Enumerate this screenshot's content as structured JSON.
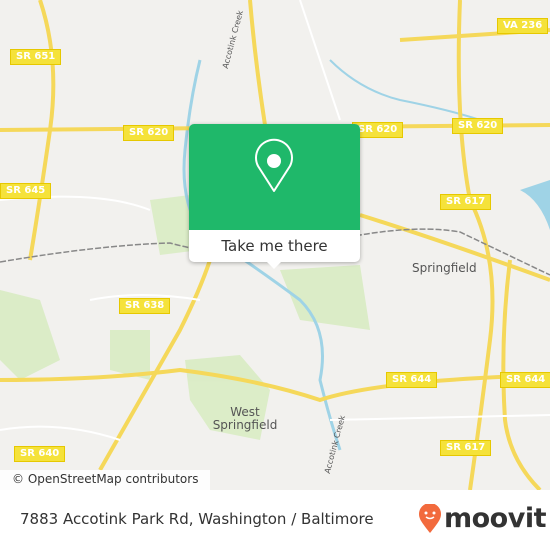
{
  "map": {
    "shields": [
      "SR 651",
      "SR 620",
      "SR 620",
      "SR 620",
      "VA 236",
      "SR 645",
      "SR 617",
      "SR 638",
      "SR 644",
      "SR 644",
      "SR 640",
      "SR 617"
    ],
    "places": [
      "Springfield",
      "West Springfield"
    ],
    "creeks": [
      "Accotink Creek",
      "Accotink Creek"
    ],
    "attribution": "© OpenStreetMap contributors"
  },
  "popup": {
    "icon": "map-pin-icon",
    "button_label": "Take me there",
    "color": "#1fb86a"
  },
  "footer": {
    "address": "7883 Accotink Park Rd, Washington / Baltimore",
    "logo": "moovit",
    "logo_color": "#f26a3d"
  }
}
